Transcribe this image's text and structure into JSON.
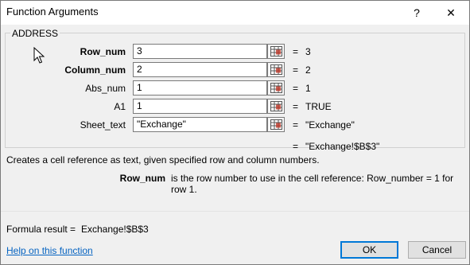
{
  "window": {
    "title": "Function Arguments"
  },
  "titlebar": {
    "help_glyph": "?",
    "close_glyph": "✕"
  },
  "group": {
    "function_name": "ADDRESS"
  },
  "arguments": [
    {
      "label": "Row_num",
      "bold": true,
      "value": "3",
      "result": "3"
    },
    {
      "label": "Column_num",
      "bold": true,
      "value": "2",
      "result": "2"
    },
    {
      "label": "Abs_num",
      "bold": false,
      "value": "1",
      "result": "1"
    },
    {
      "label": "A1",
      "bold": false,
      "value": "1",
      "result": "TRUE"
    },
    {
      "label": "Sheet_text",
      "bold": false,
      "value": "\"Exchange\"",
      "result": "\"Exchange\""
    }
  ],
  "equals_sign": "=",
  "overall_result": "\"Exchange!$B$3\"",
  "description": "Creates a cell reference as text, given specified row and column numbers.",
  "argument_help": {
    "name": "Row_num",
    "text": "is the row number to use in the cell reference: Row_number = 1 for row 1."
  },
  "formula": {
    "label": "Formula result =",
    "value": "Exchange!$B$3"
  },
  "help_link": "Help on this function",
  "buttons": {
    "ok": "OK",
    "cancel": "Cancel"
  },
  "icons": {
    "help": "help-icon",
    "close": "close-icon",
    "ref": "collapse-dialog-icon",
    "cursor": "mouse-cursor-icon"
  },
  "colors": {
    "link": "#0563c1",
    "ok_border": "#0078d7"
  }
}
